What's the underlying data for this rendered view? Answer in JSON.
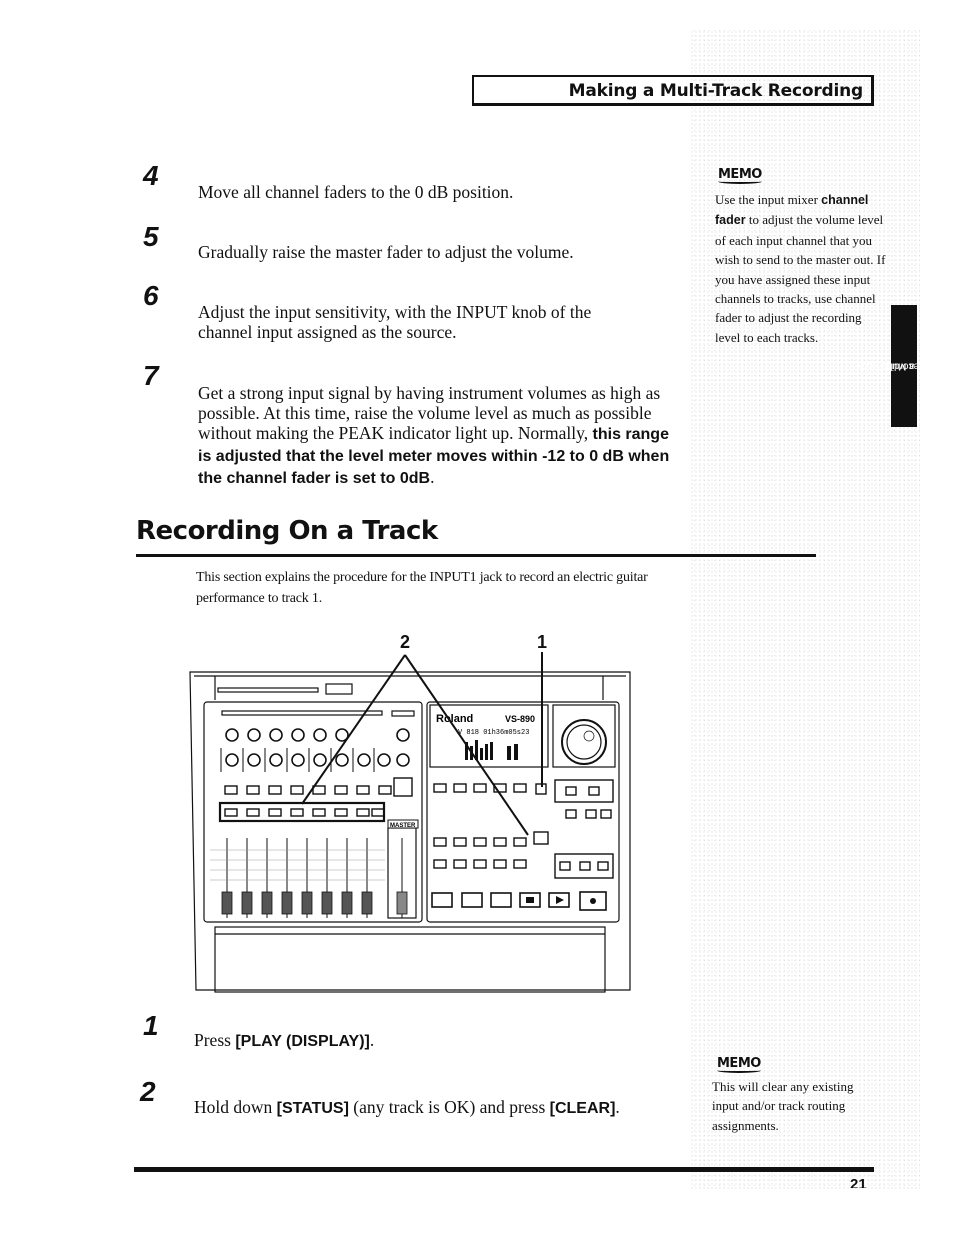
{
  "header": {
    "title": "Making a Multi-Track Recording"
  },
  "steps_top": [
    {
      "num": "4",
      "text": "Move all channel faders to the 0 dB position."
    },
    {
      "num": "5",
      "text": "Gradually raise the master fader to adjust the volume."
    },
    {
      "num": "6",
      "text": "Adjust the input sensitivity, with the INPUT knob of the channel input assigned as the source."
    },
    {
      "num": "7",
      "text_plain": "Get a strong input signal by having instrument volumes as high as possible. At this time, raise the volume level as much as possible without making the PEAK indicator light up. Normally, ",
      "text_bold": "this range is adjusted that the level meter moves within -12 to 0 dB when the channel fader is set to 0dB",
      "text_end": "."
    }
  ],
  "memo1": {
    "label": "MEMO",
    "text_a": "Use the input mixer ",
    "text_bold": "channel fader",
    "text_b": " to adjust the volume level of each input channel that you wish to send to the master out. If you have assigned these input channels to tracks, use channel fader to adjust the recording level to each tracks."
  },
  "side_tab": {
    "line1": "Making a Multi-Track",
    "line2": "Recording"
  },
  "section": {
    "title": "Recording On a Track",
    "intro": "This section explains the procedure for the INPUT1 jack to record an electric guitar performance to track 1."
  },
  "figure": {
    "callout_1": "1",
    "callout_2": "2",
    "brand": "Roland",
    "model": "VS-890",
    "display_text": "V 818  01h36m05s23",
    "master_label": "MASTER"
  },
  "steps_bottom": [
    {
      "num": "1",
      "text_a": "Press ",
      "text_bold": "[PLAY (DISPLAY)]",
      "text_b": "."
    },
    {
      "num": "2",
      "text_a": "Hold down ",
      "text_bold": "[STATUS]",
      "text_b": " (any track is OK) and press ",
      "text_bold2": "[CLEAR]",
      "text_c": "."
    }
  ],
  "memo2": {
    "label": "MEMO",
    "text": "This will clear any existing input and/or track routing assignments."
  },
  "footer": {
    "page_number": "21"
  }
}
